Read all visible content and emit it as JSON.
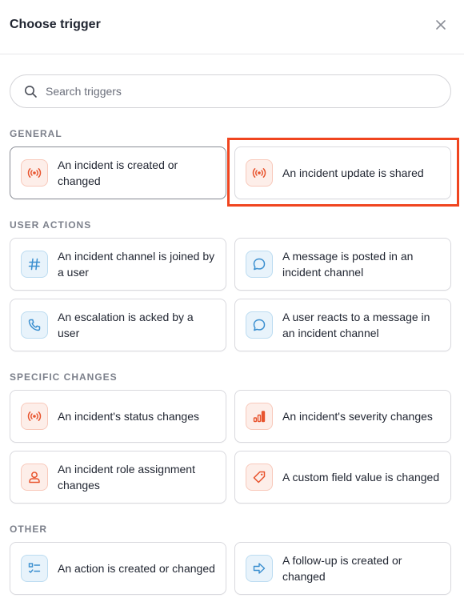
{
  "header": {
    "title": "Choose trigger"
  },
  "search": {
    "placeholder": "Search triggers"
  },
  "sections": {
    "general": "GENERAL",
    "user_actions": "USER ACTIONS",
    "specific_changes": "SPECIFIC CHANGES",
    "other": "OTHER"
  },
  "triggers": {
    "incident_created": {
      "label": "An incident is created or changed",
      "icon": "broadcast-icon",
      "color": "orange"
    },
    "incident_update_shared": {
      "label": "An incident update is shared",
      "icon": "broadcast-icon",
      "color": "orange"
    },
    "channel_joined": {
      "label": "An incident channel is joined by a user",
      "icon": "hash-icon",
      "color": "blue"
    },
    "message_posted": {
      "label": "A message is posted in an incident channel",
      "icon": "chat-bubble-icon",
      "color": "blue"
    },
    "escalation_acked": {
      "label": "An escalation is acked by a user",
      "icon": "phone-icon",
      "color": "blue"
    },
    "user_reacts": {
      "label": "A user reacts to a message in an incident channel",
      "icon": "chat-bubble-icon",
      "color": "blue"
    },
    "status_changes": {
      "label": "An incident's status changes",
      "icon": "broadcast-icon",
      "color": "orange"
    },
    "severity_changes": {
      "label": "An incident's severity changes",
      "icon": "severity-bars-icon",
      "color": "orange"
    },
    "role_assignment": {
      "label": "An incident role assignment changes",
      "icon": "user-icon",
      "color": "orange"
    },
    "custom_field": {
      "label": "A custom field value is changed",
      "icon": "tag-icon",
      "color": "orange"
    },
    "action_created": {
      "label": "An action is created or changed",
      "icon": "checklist-icon",
      "color": "blue"
    },
    "followup_created": {
      "label": "A follow-up is created or changed",
      "icon": "arrow-right-icon",
      "color": "blue"
    }
  },
  "colors": {
    "accent_orange": "#e8542e",
    "accent_blue": "#3b8fd0",
    "highlight": "#f0451f"
  }
}
